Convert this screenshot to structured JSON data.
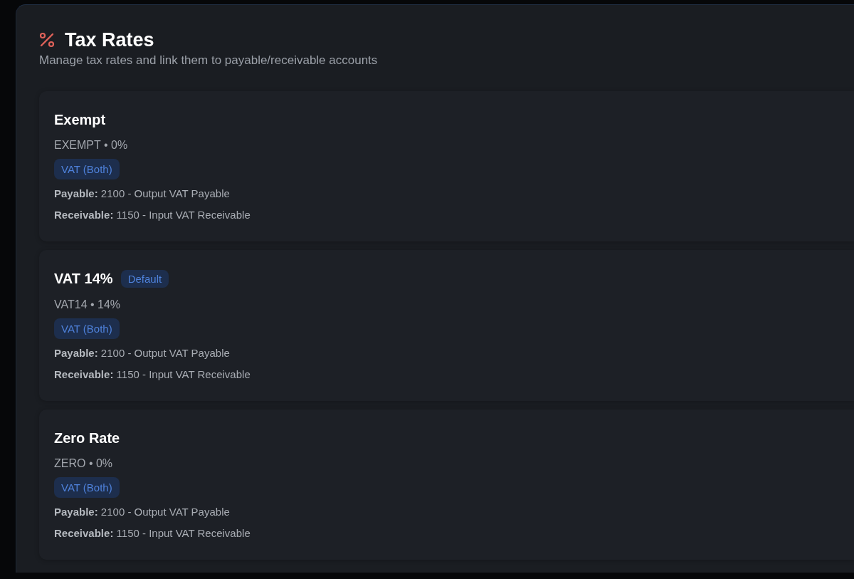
{
  "header": {
    "title": "Tax Rates",
    "subtitle": "Manage tax rates and link them to payable/receivable accounts"
  },
  "tax_rates": [
    {
      "name": "Exempt",
      "summary": "EXEMPT • 0%",
      "type": "VAT (Both)",
      "accounts": [
        "**Payable:** 2100 - Output VAT Payable",
        "**Receivable:** 1150 - Input VAT Receivable"
      ]
    },
    {
      "name": "VAT 14%",
      "tag": "Default",
      "summary": "VAT14 • 14%",
      "type": "VAT (Both)",
      "accounts": [
        "**Payable:** 2100 - Output VAT Payable",
        "**Receivable:** 1150 - Input VAT Receivable"
      ]
    },
    {
      "name": "Zero Rate",
      "summary": "ZERO • 0%",
      "type": "VAT (Both)",
      "accounts": [
        "**Payable:** 2100 - Output VAT Payable",
        "**Receivable:** 1150 - Input VAT Receivable"
      ]
    }
  ]
}
